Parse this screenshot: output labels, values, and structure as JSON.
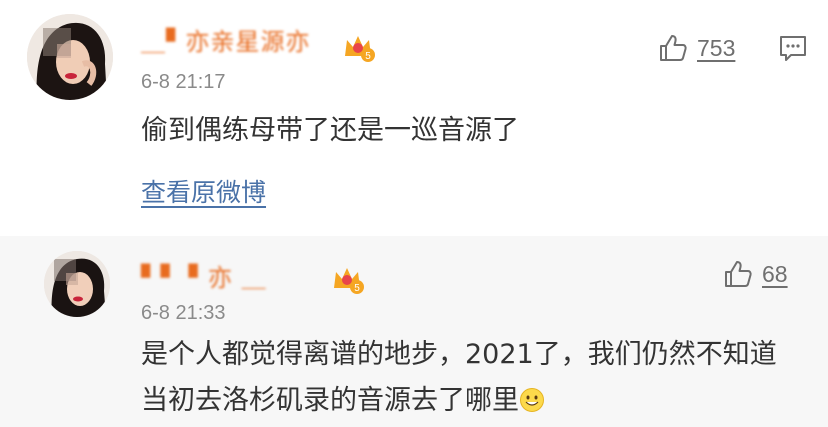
{
  "comments": [
    {
      "username": "＿▘亦亲星源亦",
      "vip_icon": "crown-vip-badge",
      "vip_level": "5",
      "time": "6-8 21:17",
      "text": "偷到偶练母带了还是一巡音源了",
      "like_count": "753",
      "view_original": "查看原微博"
    },
    {
      "username": "▘▘ ▘亦  ＿",
      "vip_icon": "crown-vip-badge",
      "vip_level": "5",
      "time": "6-8 21:33",
      "text": "是个人都觉得离谱的地步，2021了，我们仍然不知道当初去洛杉矶录的音源去了哪里",
      "emoji": "smile-emoji",
      "like_count": "68"
    }
  ],
  "icons": {
    "like": "thumbs-up-icon",
    "comment": "comment-icon"
  },
  "colors": {
    "username": "#e86b1f",
    "link": "#4a72a8",
    "text": "#333333",
    "meta": "#8a8a8a",
    "alt_background": "#f7f7f7"
  }
}
